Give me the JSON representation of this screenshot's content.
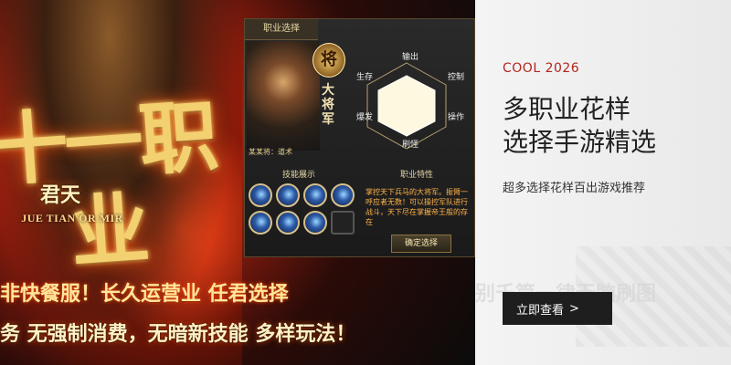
{
  "banner": {
    "big_title": "十一职业",
    "sub_cn": "君天",
    "sub_en": "JUE TIAN OR MIR",
    "slogans": [
      "非快餐服！长久运营业  任君选择",
      "务 无强制消费，无暗新技能 多样玩法！"
    ]
  },
  "game_panel": {
    "title": "职业选择",
    "rank_badge": "将",
    "rank_title": "大将军",
    "radar_labels": [
      "输出",
      "控制",
      "操作",
      "刷怪",
      "爆发",
      "生存"
    ],
    "char_name": "某某将：道术",
    "skill_header": "技能展示",
    "class_header": "职业特性",
    "description": "掌控天下兵马的大将军。振臂一呼应者无数！可以操控军队进行战斗，天下尽在掌握帝王般的存在",
    "confirm_label": "确定选择"
  },
  "card": {
    "ghost_text": "别千篇一律无脑刷图",
    "tag": "COOL 2026",
    "headline_line1": "多职业花样",
    "headline_line2": "选择手游精选",
    "subline": "超多选择花样百出游戏推荐",
    "cta_label": "立即查看",
    "cta_chevron": ">"
  },
  "colors": {
    "accent_red": "#b3261e",
    "cta_bg": "#1e1e1e",
    "gold": "#f3d070"
  }
}
